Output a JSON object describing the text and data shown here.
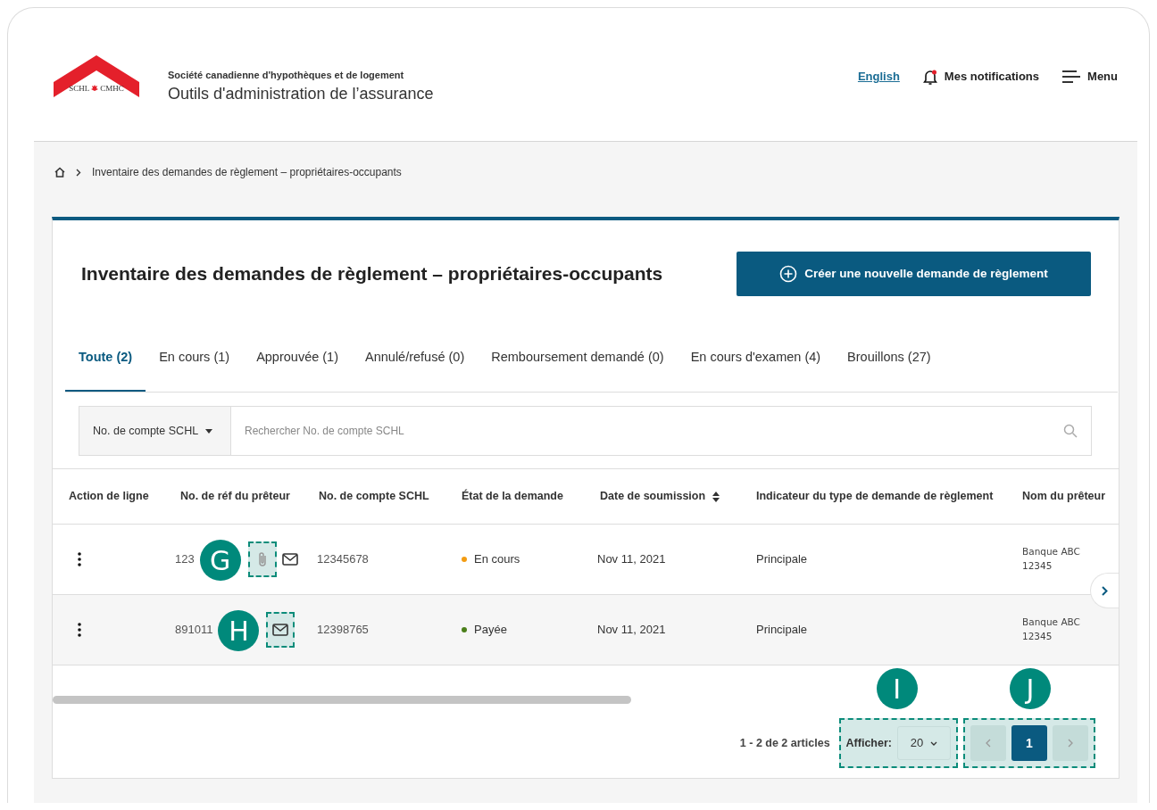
{
  "header": {
    "logo_text": "SCHL",
    "logo_text_2": "CMHC",
    "org": "Société canadienne d'hypothèques et de logement",
    "app_title": "Outils d'administration de l’assurance",
    "language_link": "English",
    "notifications": {
      "label": "Mes notifications",
      "unread": true
    },
    "menu": "Menu"
  },
  "breadcrumb": [
    "Inventaire des demandes de règlement – propriétaires-occupants"
  ],
  "page_title": "Inventaire des demandes de règlement – propriétaires-occupants",
  "create_button": "Créer une nouvelle demande de règlement",
  "tabs": [
    {
      "label": "Toute (2)",
      "selected": true
    },
    {
      "label": "En cours (1)",
      "selected": false
    },
    {
      "label": "Approuvée (1)",
      "selected": false
    },
    {
      "label": "Annulé/refusé (0)",
      "selected": false
    },
    {
      "label": "Remboursement demandé (0)",
      "selected": false
    },
    {
      "label": "En cours d'examen (4)",
      "selected": false
    },
    {
      "label": "Brouillons (27)",
      "selected": false
    }
  ],
  "search": {
    "filter": "No. de compte SCHL",
    "placeholder": "Rechercher No. de compte SCHL"
  },
  "table": {
    "columns": [
      {
        "label": "Action de ligne",
        "sortable": false
      },
      {
        "label": "No. de réf du prêteur",
        "sortable": false
      },
      {
        "label": "No. de compte SCHL",
        "sortable": false
      },
      {
        "label": "État de la demande",
        "sortable": false
      },
      {
        "label": "Date de soumission",
        "sortable": true
      },
      {
        "label": "Indicateur du type de demande de règlement",
        "sortable": false
      },
      {
        "label": "Nom du prêteur",
        "sortable": false
      }
    ],
    "rows": [
      {
        "lender_ref": "123",
        "icons": [
          {
            "kind": "attachment",
            "callout": "G"
          },
          {
            "kind": "mail"
          }
        ],
        "account": "12345678",
        "status": "En cours",
        "color": "#f39c12",
        "date": "Nov 11, 2021",
        "type": "Principale",
        "lender_name": "Banque ABC",
        "lender_code": "12345"
      },
      {
        "lender_ref": "891011",
        "icons": [
          {
            "kind": "mail",
            "callout": "H"
          }
        ],
        "account": "12398765",
        "status": "Payée",
        "color": "#4a7f1a",
        "date": "Nov 11, 2021",
        "type": "Principale",
        "lender_name": "Banque ABC",
        "lender_code": "12345"
      }
    ]
  },
  "footer": {
    "range": "1 - 2 de 2 articles",
    "page_size_label": "Afficher:",
    "page_size": "20",
    "page_size_callout": "I",
    "pages": [
      {
        "label": "1",
        "selected": true
      }
    ],
    "pages_callout": "J"
  }
}
